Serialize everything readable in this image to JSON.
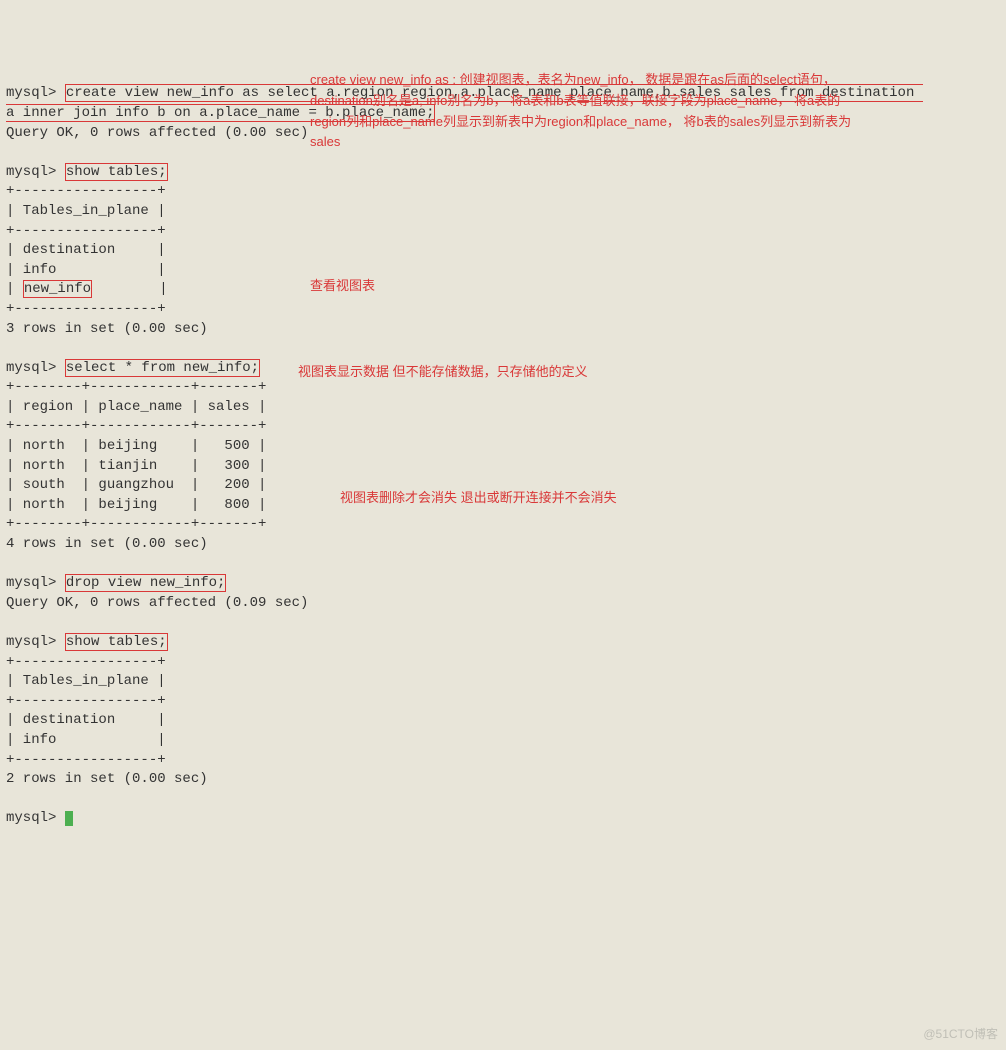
{
  "cmd1_prefix": "mysql> ",
  "cmd1_body": "create view new_info as select a.region region,a.place_name place_name,b.sales sales from destination \na inner join info b on a.place_name = b.place_name;",
  "result1": "Query OK, 0 rows affected (0.00 sec)",
  "cmd2_prefix": "mysql> ",
  "cmd2_body": "show tables;",
  "tables_output1": "+-----------------+\n| Tables_in_plane |\n+-----------------+\n| destination     |\n| info            |\n| ",
  "tables_output1_newinfo": "new_info",
  "tables_output1_end": "        |\n+-----------------+\n3 rows in set (0.00 sec)",
  "cmd3_prefix": "mysql> ",
  "cmd3_body": "select * from new_info;",
  "select_output": "+--------+------------+-------+\n| region | place_name | sales |\n+--------+------------+-------+\n| north  | beijing    |   500 |\n| north  | tianjin    |   300 |\n| south  | guangzhou  |   200 |\n| north  | beijing    |   800 |\n+--------+------------+-------+\n4 rows in set (0.00 sec)",
  "cmd4_prefix": "mysql> ",
  "cmd4_body": "drop view new_info;",
  "result4": "Query OK, 0 rows affected (0.09 sec)",
  "cmd5_prefix": "mysql> ",
  "cmd5_body": "show tables;",
  "tables_output2": "+-----------------+\n| Tables_in_plane |\n+-----------------+\n| destination     |\n| info            |\n+-----------------+\n2 rows in set (0.00 sec)",
  "final_prompt": "mysql> ",
  "annotation1": "create view new_info as : 创建视图表，表名为new_info，\n数据是跟在as后面的select语句，\ndestination别名是a, info别名为b，\n将a表和b表等值联接，联接字段为place_name，\n将a表的region列和place_name列显示到新表中为region和place_name，\n将b表的sales列显示到新表为sales",
  "annotation2": "查看视图表",
  "annotation3": "视图表显示数据\n但不能存储数据，只存储他的定义",
  "annotation4": "视图表删除才会消失\n退出或断开连接并不会消失",
  "watermark": "@51CTO博客",
  "chart_data": {
    "type": "table",
    "columns": [
      "region",
      "place_name",
      "sales"
    ],
    "rows": [
      [
        "north",
        "beijing",
        500
      ],
      [
        "north",
        "tianjin",
        300
      ],
      [
        "south",
        "guangzhou",
        200
      ],
      [
        "north",
        "beijing",
        800
      ]
    ],
    "title": "select * from new_info;"
  }
}
